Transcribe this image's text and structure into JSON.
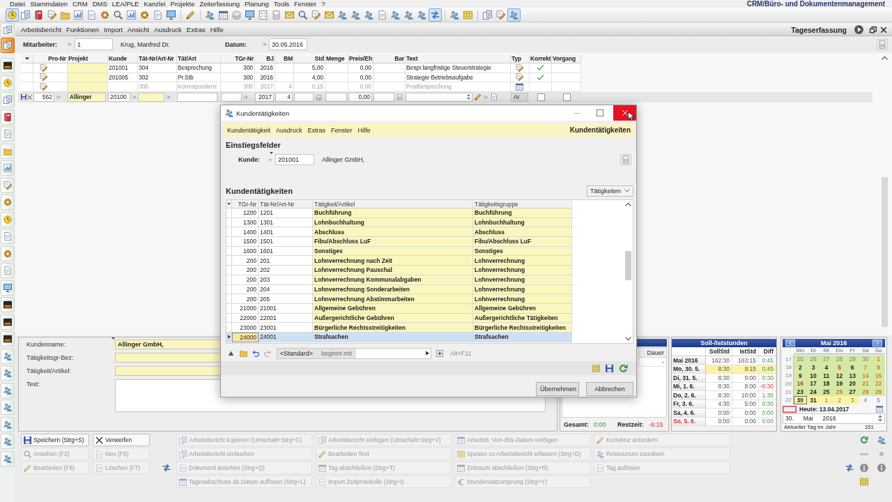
{
  "menu_bar": {
    "items": [
      "Datei",
      "Stammdaten",
      "CRM",
      "DMS",
      "LEA/PLE",
      "Kanzlei",
      "Projekte",
      "Zeiterfassung",
      "Planung",
      "Tools",
      "Fenster",
      "?"
    ],
    "product": "CRM/Büro- und Dokumentenmanagement"
  },
  "toolbar": {
    "groups": [
      {
        "buttons": [
          {
            "selected": true
          },
          {
            "selected": false
          },
          {
            "selected": false
          },
          {
            "selected": false
          },
          {
            "selected": false
          },
          {
            "selected": false
          },
          {
            "selected": false
          },
          {
            "selected": false
          },
          {
            "selected": false
          },
          {
            "selected": false
          },
          {
            "selected": false
          },
          {
            "selected": false
          },
          {
            "selected": false
          }
        ]
      },
      {
        "buttons": [
          {
            "selected": false
          }
        ]
      },
      {
        "buttons": [
          {
            "selected": false
          },
          {
            "selected": false
          },
          {
            "selected": false
          },
          {
            "selected": false
          },
          {
            "selected": false
          },
          {
            "selected": false
          },
          {
            "selected": false
          },
          {
            "selected": false
          },
          {
            "selected": false
          },
          {
            "selected": false
          },
          {
            "selected": false
          },
          {
            "selected": false
          },
          {
            "selected": false
          },
          {
            "selected": false
          },
          {
            "selected": false
          },
          {
            "selected": false
          },
          {
            "selected": false
          },
          {
            "selected": true
          }
        ]
      },
      {
        "buttons": [
          {
            "selected": false
          },
          {
            "selected": false
          }
        ]
      },
      {
        "buttons": [
          {
            "selected": false
          },
          {
            "selected": false
          },
          {
            "selected": true
          }
        ]
      }
    ]
  },
  "sidebar": [
    {
      "selected": false
    },
    {
      "selected": true
    },
    {
      "selected": false
    },
    {
      "selected": false
    },
    {
      "selected": false
    },
    {
      "selected": false
    },
    {
      "selected": false
    },
    {
      "selected": false
    },
    {
      "selected": false
    },
    {
      "selected": false
    },
    {
      "selected": false
    },
    {
      "selected": false
    },
    {
      "selected": false
    },
    {
      "selected": false
    },
    {
      "selected": false
    },
    {
      "selected": false
    },
    {
      "selected": false
    },
    {
      "selected": false
    },
    {
      "selected": false
    },
    {
      "selected": false
    },
    {
      "selected": false
    },
    {
      "selected": false
    },
    {
      "selected": false
    },
    {
      "selected": false
    },
    {
      "selected": false
    },
    {
      "selected": false
    }
  ],
  "work_window": {
    "menu": [
      "Arbeitsbericht",
      "Funktionen",
      "Import",
      "Ansicht",
      "Ausdruck",
      "Extras",
      "Hilfe"
    ],
    "title": "Tageserfassung",
    "employee": {
      "label": "Mitarbeiter:",
      "value": "1",
      "name": "Krug, Manfred Dr."
    },
    "date": {
      "label": "Datum:",
      "value": "30.05.2016"
    },
    "table": {
      "columns": [
        "Pro-Nr",
        "Projekt",
        "Kunde",
        "Tät-Nr/Art-Nr",
        "Tät/Art",
        "TGr-Nr",
        "BJ",
        "BM",
        "Std",
        "Menge",
        "Preis/Eh",
        "Bar",
        "Text",
        "Typ",
        "Korrekt",
        "Vorgang"
      ],
      "rows": [
        {
          "customer": "201001",
          "activity_no": "304",
          "activity": "Besprechung",
          "group_no": "300",
          "year": "2016",
          "hours": "5,00",
          "price": "0,00",
          "text": "Bespr.langfristige Steuerstrategie",
          "kind": "note",
          "correct": true,
          "disabled": false
        },
        {
          "customer": "201005",
          "activity_no": "302",
          "activity": "Pr.Stb",
          "group_no": "300",
          "year": "2016",
          "hours": "4,00",
          "price": "0,00",
          "text": "Strategie Betriebsaufgabe",
          "kind": "note",
          "correct": true,
          "disabled": false
        },
        {
          "activity_no": "305",
          "activity": "Korrespondenz",
          "group_no": "300",
          "year": "2017",
          "month": "4",
          "hours": "0,15",
          "price": "0,00",
          "text": "Postbesprechung",
          "kind": "calendar",
          "correct": false,
          "disabled": true
        }
      ],
      "edit_row": {
        "project_no": "562",
        "project": "Allinger",
        "customer": "20100",
        "year": "2017",
        "month": "4",
        "price": "0,00",
        "button": "Ar",
        "correct": false,
        "process": false
      }
    }
  },
  "dialog": {
    "title": "Kundentätigkeiten",
    "close_hovered": true,
    "menu": [
      "Kundentätigkeit",
      "Ausdruck",
      "Extras",
      "Fenster",
      "Hilfe"
    ],
    "menu_title": "Kundentätigkeiten",
    "entry_heading": "Einstiegsfelder",
    "customer": {
      "label": "Kunde:",
      "value": "201001",
      "name": "Allinger GmbH,"
    },
    "list_heading": "Kundentätigkeiten",
    "view": "Tätigkeiten",
    "table": {
      "columns": [
        "TGr-Nr",
        "Tät-Nr/Art-Nr",
        "Tätigkeit/Artikel",
        "Tätigkeitsgruppe"
      ],
      "rows": [
        {
          "cells": [
            "1200",
            "1201",
            "Buchführung",
            "Buchführung"
          ],
          "selected": false
        },
        {
          "cells": [
            "1300",
            "1301",
            "Lohnbuchhaltung",
            "Lohnbuchhaltung"
          ],
          "selected": false
        },
        {
          "cells": [
            "1400",
            "1401",
            "Abschluss",
            "Abschluss"
          ],
          "selected": false
        },
        {
          "cells": [
            "1500",
            "1501",
            "Fibu/Abschluss LuF",
            "Fibu/Abschluss LuF"
          ],
          "selected": false
        },
        {
          "cells": [
            "1600",
            "1601",
            "Sonstiges",
            "Sonstiges"
          ],
          "selected": false
        },
        {
          "cells": [
            "200",
            "201",
            "Lohnverrechnung nach Zeit",
            "Lohnverrechnung"
          ],
          "selected": false
        },
        {
          "cells": [
            "200",
            "202",
            "Lohnverrechnung Pauschal",
            "Lohnverrechnung"
          ],
          "selected": false
        },
        {
          "cells": [
            "200",
            "203",
            "Lohnverrechnung Kommunalabgaben",
            "Lohnverrechnung"
          ],
          "selected": false
        },
        {
          "cells": [
            "200",
            "204",
            "Lohnverrechnung Sonderarbeiten",
            "Lohnverrechnung"
          ],
          "selected": false
        },
        {
          "cells": [
            "200",
            "205",
            "Lohnverrechnung Abstimmarbeiten",
            "Lohnverrechnung"
          ],
          "selected": false
        },
        {
          "cells": [
            "21000",
            "21001",
            "Allgemeine Gebühren",
            "Allgemeine Gebühren"
          ],
          "selected": false
        },
        {
          "cells": [
            "22000",
            "22001",
            "Außergerichtliche Gebühren",
            "Außergerichtliche Tätigkeiten"
          ],
          "selected": false
        },
        {
          "cells": [
            "23000",
            "23001",
            "Bürgerliche Rechtsstreitigkeiten",
            "Bürgerliche Rechtsstreitigkeiten"
          ],
          "selected": false
        },
        {
          "cells": [
            "24000",
            "24001",
            "Strafsachen",
            "Strafsachen"
          ],
          "selected": true
        }
      ]
    },
    "filter": {
      "field": "<Standard>",
      "operator": "beginnt mit",
      "shortcut": "Alt+F11"
    },
    "buttons": [
      "Übernehmen",
      "Abbrechen"
    ]
  },
  "details": {
    "fields": [
      {
        "label": "Kundenname:",
        "value": "Allinger GmbH,",
        "kind": "line"
      },
      {
        "label": "Tätigkeitsgr-Bez:",
        "kind": "line"
      },
      {
        "label": "Tätigkeit/Artikel:",
        "kind": "line"
      },
      {
        "label": "Text:",
        "kind": "multiline"
      }
    ]
  },
  "time_panel": {
    "column": "Dauer",
    "cell": "-",
    "total_label": "Gesamt:",
    "total": "0:00",
    "rest_label": "Restzeit:",
    "rest": "-9:15"
  },
  "hours": {
    "title": "Soll-/Iststunden",
    "columns": [
      "SollStd",
      "IstStd",
      "Diff"
    ],
    "rows": [
      {
        "label": "Mai 2016",
        "target": "162:30",
        "actual": "163:15",
        "diff": "0:45",
        "negative": false,
        "sunday": false,
        "selected": false
      },
      {
        "label": "Mo, 30. 5.",
        "target": "8:30",
        "actual": "9:15",
        "diff": "0:45",
        "negative": false,
        "sunday": false,
        "selected": true
      },
      {
        "label": "Di, 31. 5.",
        "target": "8:30",
        "actual": "9:00",
        "diff": "0:30",
        "negative": false,
        "sunday": false,
        "selected": false
      },
      {
        "label": "Mi, 1. 6.",
        "target": "8:30",
        "actual": "8:00",
        "diff": "-0:30",
        "negative": true,
        "sunday": false,
        "selected": false
      },
      {
        "label": "Do, 2. 6.",
        "target": "8:30",
        "actual": "10:00",
        "diff": "1:30",
        "negative": false,
        "sunday": false,
        "selected": false
      },
      {
        "label": "Fr, 3. 6.",
        "target": "4:30",
        "actual": "5:00",
        "diff": "0:30",
        "negative": false,
        "sunday": false,
        "selected": false
      },
      {
        "label": "Sa, 4. 6.",
        "target": "0:00",
        "actual": "0:00",
        "diff": "0:00",
        "negative": false,
        "sunday": false,
        "selected": false
      },
      {
        "label": "So, 5. 6.",
        "target": "0:00",
        "actual": "0:00",
        "diff": "0:00",
        "negative": false,
        "sunday": true,
        "selected": false
      }
    ]
  },
  "calendar": {
    "month": "Mai 2016",
    "weekdays": [
      "Mo",
      "Di",
      "Mi",
      "Do",
      "Fr",
      "Sa",
      "So"
    ],
    "weeks": [
      {
        "number": "17",
        "days": [
          {
            "text": "25",
            "kind": "outside",
            "color": "#d5e9a6",
            "selected": false
          },
          {
            "text": "26",
            "kind": "outside",
            "color": "#d5e9a6",
            "selected": false
          },
          {
            "text": "27",
            "kind": "outside",
            "color": "#d5e9a6",
            "selected": false
          },
          {
            "text": "28",
            "kind": "outside",
            "color": "#d5e9a6",
            "selected": false
          },
          {
            "text": "29",
            "kind": "outside",
            "color": "#d5e9a6",
            "selected": false
          },
          {
            "text": "30",
            "kind": "outside",
            "color": "#d5e9a6",
            "selected": false
          },
          {
            "text": "1",
            "kind": "dayoff",
            "color": "#d5e9a6",
            "selected": false
          }
        ]
      },
      {
        "number": "18",
        "days": [
          {
            "text": "2",
            "kind": "workday",
            "color": "#d5e9a6",
            "selected": false
          },
          {
            "text": "3",
            "kind": "workday",
            "color": "#d5e9a6",
            "selected": false
          },
          {
            "text": "4",
            "kind": "workday",
            "color": "#d5e9a6",
            "selected": false
          },
          {
            "text": "5",
            "kind": "holiday",
            "color": "#d5e9a6",
            "selected": false
          },
          {
            "text": "6",
            "kind": "workday",
            "color": "#d5e9a6",
            "selected": false
          },
          {
            "text": "7",
            "kind": "dayoff",
            "color": "#d5e9a6",
            "selected": false
          },
          {
            "text": "8",
            "kind": "dayoff",
            "color": "#d5e9a6",
            "selected": false
          }
        ]
      },
      {
        "number": "19",
        "days": [
          {
            "text": "9",
            "kind": "workday",
            "color": "#d5e9a6",
            "selected": false
          },
          {
            "text": "10",
            "kind": "workday",
            "color": "#d5e9a6",
            "selected": false
          },
          {
            "text": "11",
            "kind": "workday",
            "color": "#d5e9a6",
            "selected": false
          },
          {
            "text": "12",
            "kind": "workday",
            "color": "#d5e9a6",
            "selected": false
          },
          {
            "text": "13",
            "kind": "workday",
            "color": "#d5e9a6",
            "selected": false
          },
          {
            "text": "14",
            "kind": "dayoff",
            "color": "#d5e9a6",
            "selected": false
          },
          {
            "text": "15",
            "kind": "dayoff",
            "color": "#d5e9a6",
            "selected": false
          }
        ]
      },
      {
        "number": "20",
        "days": [
          {
            "text": "16",
            "kind": "holiday",
            "color": "#d5e9a6",
            "selected": false
          },
          {
            "text": "17",
            "kind": "workday",
            "color": "#d5e9a6",
            "selected": false
          },
          {
            "text": "18",
            "kind": "workday",
            "color": "#d5e9a6",
            "selected": false
          },
          {
            "text": "19",
            "kind": "workday",
            "color": "#d5e9a6",
            "selected": false
          },
          {
            "text": "20",
            "kind": "workday",
            "color": "#d5e9a6",
            "selected": false
          },
          {
            "text": "21",
            "kind": "dayoff",
            "color": "#d5e9a6",
            "selected": false
          },
          {
            "text": "22",
            "kind": "dayoff",
            "color": "#d5e9a6",
            "selected": false
          }
        ]
      },
      {
        "number": "21",
        "days": [
          {
            "text": "23",
            "kind": "workday",
            "color": "#d5e9a6",
            "selected": false
          },
          {
            "text": "24",
            "kind": "workday",
            "color": "#d5e9a6",
            "selected": false
          },
          {
            "text": "25",
            "kind": "workday",
            "color": "#d5e9a6",
            "selected": false
          },
          {
            "text": "26",
            "kind": "dayoff",
            "color": "#d5e9a6",
            "selected": false
          },
          {
            "text": "27",
            "kind": "workday",
            "color": "#d5e9a6",
            "selected": false
          },
          {
            "text": "28",
            "kind": "dayoff",
            "color": "#d5e9a6",
            "selected": false
          },
          {
            "text": "29",
            "kind": "dayoff",
            "color": "#d5e9a6",
            "selected": false
          }
        ]
      },
      {
        "number": "22",
        "days": [
          {
            "text": "30",
            "kind": "workday",
            "color": "#fdf3a4",
            "selected": true
          },
          {
            "text": "31",
            "kind": "workday",
            "color": "#fdf3a4",
            "selected": false
          },
          {
            "text": "1",
            "kind": "outside",
            "color": "#fdf3a4",
            "selected": false
          },
          {
            "text": "2",
            "kind": "outside",
            "color": "#fdf3a4",
            "selected": false
          },
          {
            "text": "3",
            "kind": "outside",
            "color": "#fdf3a4",
            "selected": false
          },
          {
            "text": "4",
            "kind": "outside",
            "selected": false
          },
          {
            "text": "5",
            "kind": "outside",
            "selected": false
          }
        ]
      }
    ],
    "today": "Heute: 13.04.2017",
    "date": {
      "day": "30.",
      "month": "Mai",
      "year": "2016"
    },
    "day_of_year": {
      "label": "Aktueller Tag im Jahr",
      "value": "151"
    }
  },
  "actions": {
    "groups": [
      {
        "actions": [
          {
            "label": "Speichern (Strg+S)",
            "disabled": false
          },
          {
            "label": "Ansehen (F2)",
            "disabled": true
          },
          {
            "label": "Bearbeiten (F6)",
            "disabled": true
          }
        ]
      },
      {
        "actions": [
          {
            "label": "Verwerfen",
            "disabled": false
          },
          {
            "label": "Neu (F5)",
            "disabled": true
          },
          {
            "label": "Löschen (F7)",
            "disabled": true
          }
        ]
      },
      {
        "actions": [
          {
            "label": "Arbeitsbericht kopieren (Umschalt+Strg+C)",
            "disabled": true
          },
          {
            "label": "Arbeitsbericht umbuchen",
            "disabled": true
          },
          {
            "label": "Dokument ansehen (Strg+Q)",
            "disabled": true
          },
          {
            "label": "Tagesabschluss ab Datum auflösen (Strg+L)",
            "disabled": true
          }
        ]
      },
      {
        "actions": [
          {
            "label": "Arbeitsbericht einfügen (Umschalt+Strg+V)",
            "disabled": true
          },
          {
            "label": "Bearbeiten Text",
            "disabled": true
          },
          {
            "label": "Tag abschließen (Strg+T)",
            "disabled": true
          },
          {
            "label": "Import Zeitprotokolle (Strg+I)",
            "disabled": true
          }
        ]
      },
      {
        "actions": [
          {
            "label": "Arbeitsb. Von-/Bis-Datum einfügen",
            "disabled": true
          },
          {
            "label": "Spesen zu Arbeitsbericht erfassen (Strg+D)",
            "disabled": true
          },
          {
            "label": "Zeitraum abschließen (Strg+R)",
            "disabled": true
          },
          {
            "label": "Stundensatzursprung (Strg+Y)",
            "disabled": true
          }
        ]
      },
      {
        "actions": [
          {
            "label": "Korrektur anfordern",
            "disabled": true
          },
          {
            "label": "Ressourcen zuordnen",
            "disabled": true
          },
          {
            "label": "Tag auflösen",
            "disabled": true
          }
        ]
      }
    ]
  }
}
